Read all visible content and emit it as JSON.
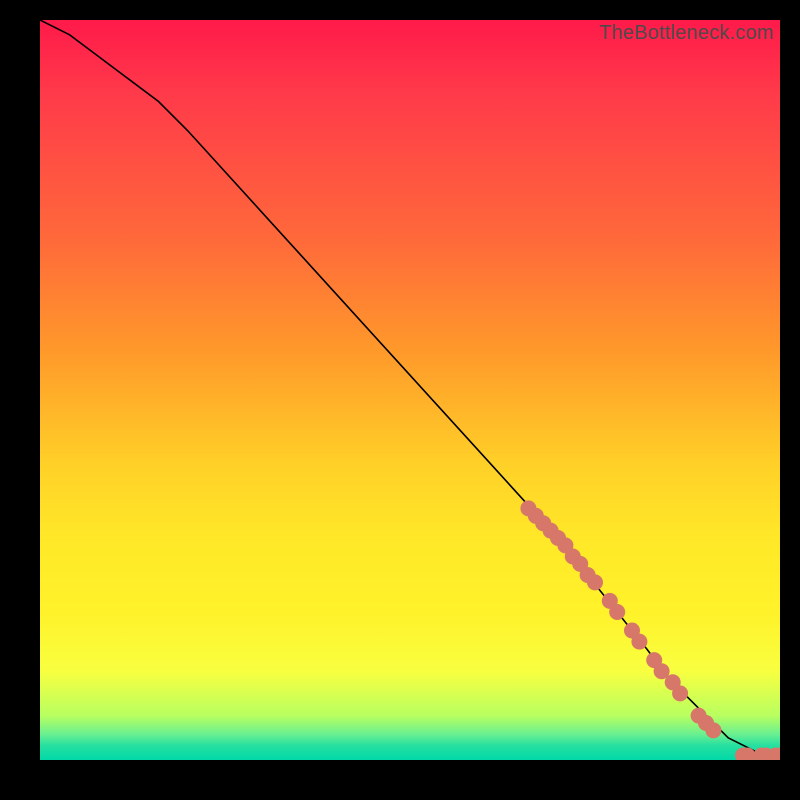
{
  "watermark": "TheBottleneck.com",
  "colors": {
    "page_bg": "#000000",
    "curve": "#000000",
    "marker_fill": "#d6776a",
    "marker_stroke": "#b45a4e",
    "gradient_stops": [
      "#ff1a4a",
      "#ff3a4a",
      "#ff6a3a",
      "#ff9a2a",
      "#ffd028",
      "#ffe828",
      "#fff22a",
      "#f8ff40",
      "#b8ff60",
      "#6af090",
      "#28e0a0",
      "#00d8a8"
    ]
  },
  "chart_data": {
    "type": "line",
    "title": "",
    "xlabel": "",
    "ylabel": "",
    "xlim": [
      0,
      100
    ],
    "ylim": [
      0,
      100
    ],
    "series": [
      {
        "name": "curve",
        "x": [
          0,
          4,
          8,
          12,
          16,
          20,
          30,
          40,
          50,
          60,
          70,
          78,
          82,
          85,
          88,
          91,
          93,
          95,
          97,
          99,
          100
        ],
        "y": [
          100,
          98,
          95,
          92,
          89,
          85,
          74,
          63,
          52,
          41,
          30,
          20,
          15,
          11,
          8,
          5,
          3,
          2,
          1,
          0.5,
          0.5
        ]
      }
    ],
    "markers": [
      {
        "x": 66,
        "y": 34
      },
      {
        "x": 67,
        "y": 33
      },
      {
        "x": 68,
        "y": 32
      },
      {
        "x": 69,
        "y": 31
      },
      {
        "x": 70,
        "y": 30
      },
      {
        "x": 71,
        "y": 29
      },
      {
        "x": 72,
        "y": 27.5
      },
      {
        "x": 73,
        "y": 26.5
      },
      {
        "x": 74,
        "y": 25
      },
      {
        "x": 75,
        "y": 24
      },
      {
        "x": 77,
        "y": 21.5
      },
      {
        "x": 78,
        "y": 20
      },
      {
        "x": 80,
        "y": 17.5
      },
      {
        "x": 81,
        "y": 16
      },
      {
        "x": 83,
        "y": 13.5
      },
      {
        "x": 84,
        "y": 12
      },
      {
        "x": 85.5,
        "y": 10.5
      },
      {
        "x": 86.5,
        "y": 9
      },
      {
        "x": 89,
        "y": 6
      },
      {
        "x": 90,
        "y": 5
      },
      {
        "x": 91,
        "y": 4
      },
      {
        "x": 95,
        "y": 0.6
      },
      {
        "x": 95.6,
        "y": 0.6
      },
      {
        "x": 97.5,
        "y": 0.6
      },
      {
        "x": 98.1,
        "y": 0.6
      },
      {
        "x": 99.4,
        "y": 0.6
      },
      {
        "x": 100,
        "y": 0.6
      }
    ]
  }
}
